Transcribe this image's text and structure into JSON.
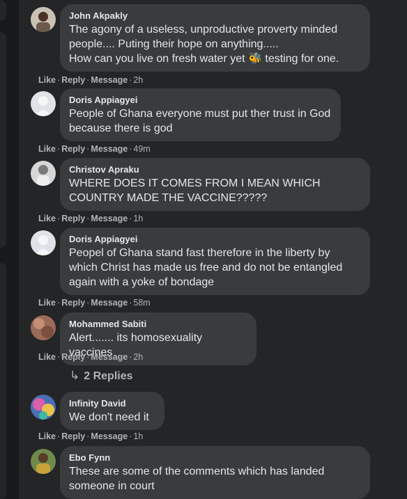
{
  "comments": [
    {
      "name": "John Akpakly",
      "text": "The agony of a useless, unproductive proverty minded\npeople.... Puting their hope on anything.....\nHow can you live on fresh water yet 🐝 testing for one.",
      "like": "Like",
      "reply": "Reply",
      "message": "Message",
      "time": "2h"
    },
    {
      "name": "Doris Appiagyei",
      "text": "People of Ghana everyone must put ther trust in God\nbecause there is god",
      "like": "Like",
      "reply": "Reply",
      "message": "Message",
      "time": "49m"
    },
    {
      "name": "Christov Apraku",
      "text": "WHERE DOES IT COMES FROM I MEAN WHICH\nCOUNTRY MADE THE VACCINE?????",
      "like": "Like",
      "reply": "Reply",
      "message": "Message",
      "time": "1h"
    },
    {
      "name": "Doris Appiagyei",
      "text": "Peopel of Ghana stand fast therefore in the liberty by\nwhich Christ has made us free and do not be entangled\nagain with a yoke of bondage",
      "like": "Like",
      "reply": "Reply",
      "message": "Message",
      "time": "58m"
    },
    {
      "name": "Mohammed Sabiti",
      "text": "Alert....... its homosexuality vaccines",
      "like": "Like",
      "reply": "Reply",
      "message": "Message",
      "time": "2h"
    },
    {
      "name": "Infinity David",
      "text": "We don't need it",
      "like": "Like",
      "reply": "Reply",
      "message": "Message",
      "time": "1h"
    },
    {
      "name": "Ebo Fynn",
      "text": "These are some of the comments which has landed\nsomeone in court"
    }
  ],
  "replies_link": {
    "label": "2 Replies",
    "icon": "reply-arrow-icon"
  },
  "colors": {
    "background": "#18191a",
    "panel": "#242526",
    "bubble": "#3a3b3c",
    "text": "#e4e6eb",
    "muted": "#b0b3b8"
  }
}
